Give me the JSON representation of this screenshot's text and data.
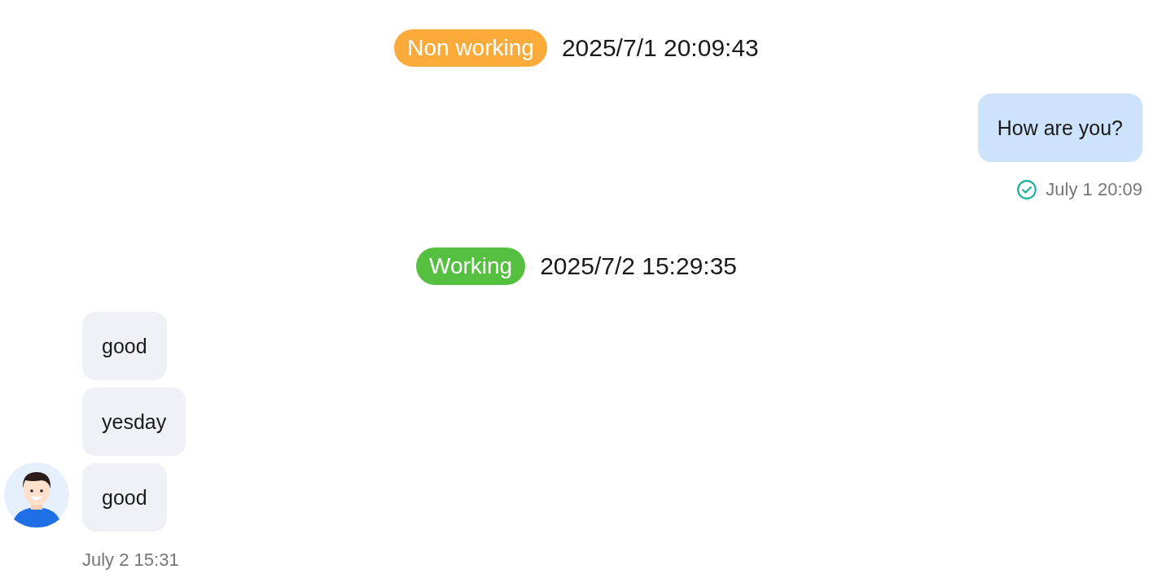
{
  "messages": [
    {
      "kind": "status",
      "label": "Non working",
      "color": "#fbab3a",
      "time": "2025/7/1 20:09:43"
    },
    {
      "kind": "sent",
      "bubbles": [
        "How are you?"
      ],
      "read": true,
      "time": "July 1 20:09"
    },
    {
      "kind": "status",
      "label": "Working",
      "color": "#55c03f",
      "time": "2025/7/2 15:29:35"
    },
    {
      "kind": "received",
      "bubbles": [
        "good",
        "yesday",
        "good"
      ],
      "time": "July 2 15:31"
    }
  ]
}
